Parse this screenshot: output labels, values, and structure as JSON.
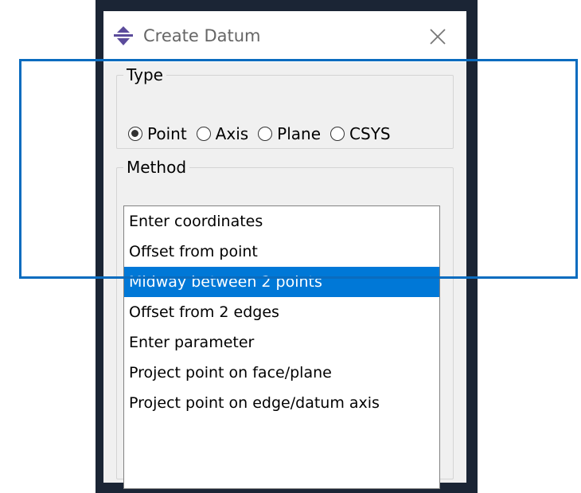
{
  "dialog": {
    "title": "Create Datum",
    "icon": "datum-icon",
    "close_icon": "close-icon"
  },
  "type_group": {
    "legend": "Type",
    "options": [
      {
        "label": "Point",
        "checked": true
      },
      {
        "label": "Axis",
        "checked": false
      },
      {
        "label": "Plane",
        "checked": false
      },
      {
        "label": "CSYS",
        "checked": false
      }
    ]
  },
  "method_group": {
    "legend": "Method",
    "items": [
      {
        "label": "Enter coordinates",
        "selected": false
      },
      {
        "label": "Offset from point",
        "selected": false
      },
      {
        "label": "Midway between 2 points",
        "selected": true
      },
      {
        "label": "Offset from 2 edges",
        "selected": false
      },
      {
        "label": "Enter parameter",
        "selected": false
      },
      {
        "label": "Project point on face/plane",
        "selected": false
      },
      {
        "label": "Project point on edge/datum axis",
        "selected": false
      }
    ]
  },
  "colors": {
    "selection": "#0078d7",
    "highlight_frame": "#0a6cbf",
    "background_dark": "#1b2535"
  }
}
